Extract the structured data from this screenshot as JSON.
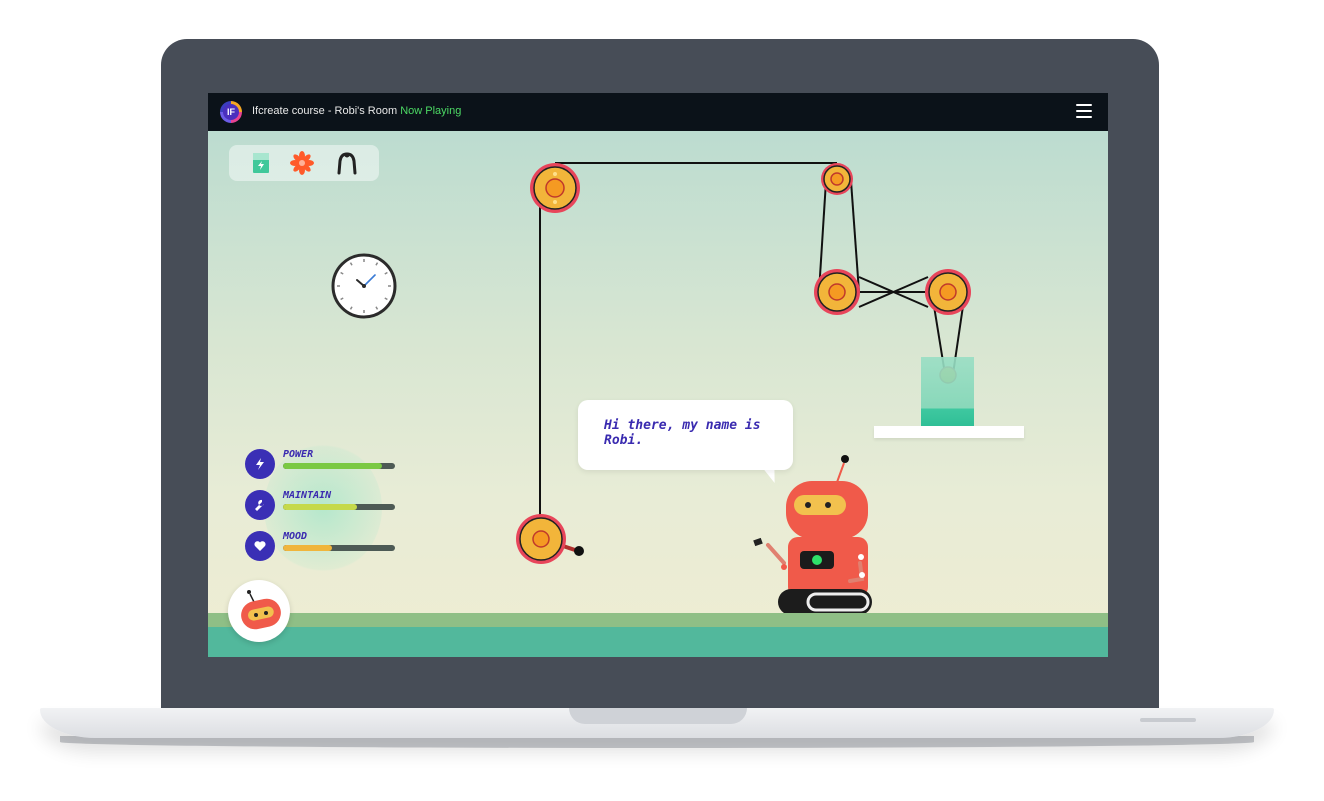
{
  "app": {
    "logo_text": "IF",
    "title": "Ifcreate course - Robi's Room",
    "status": "Now Playing"
  },
  "toolbar": {
    "tools": [
      {
        "icon": "battery-icon",
        "color": "#3fc89a"
      },
      {
        "icon": "gear-flower-icon",
        "color": "#ff5a2a"
      },
      {
        "icon": "claw-icon",
        "color": "#222222"
      }
    ]
  },
  "speech": {
    "text": "Hi there, my name is Robi."
  },
  "stats": [
    {
      "label": "POWER",
      "icon": "lightning-icon",
      "level": 0.88,
      "color": "#7ac943"
    },
    {
      "label": "MAINTAIN",
      "icon": "wrench-icon",
      "level": 0.66,
      "color": "#c5d94a"
    },
    {
      "label": "MOOD",
      "icon": "heart-icon",
      "level": 0.44,
      "color": "#f0b53c"
    }
  ],
  "colors": {
    "accent": "#3a2bb0",
    "robot": "#f05a4a",
    "pulley": "#f2b53a",
    "pulley_ring": "#e8455a",
    "topbar": "#0b1219"
  }
}
